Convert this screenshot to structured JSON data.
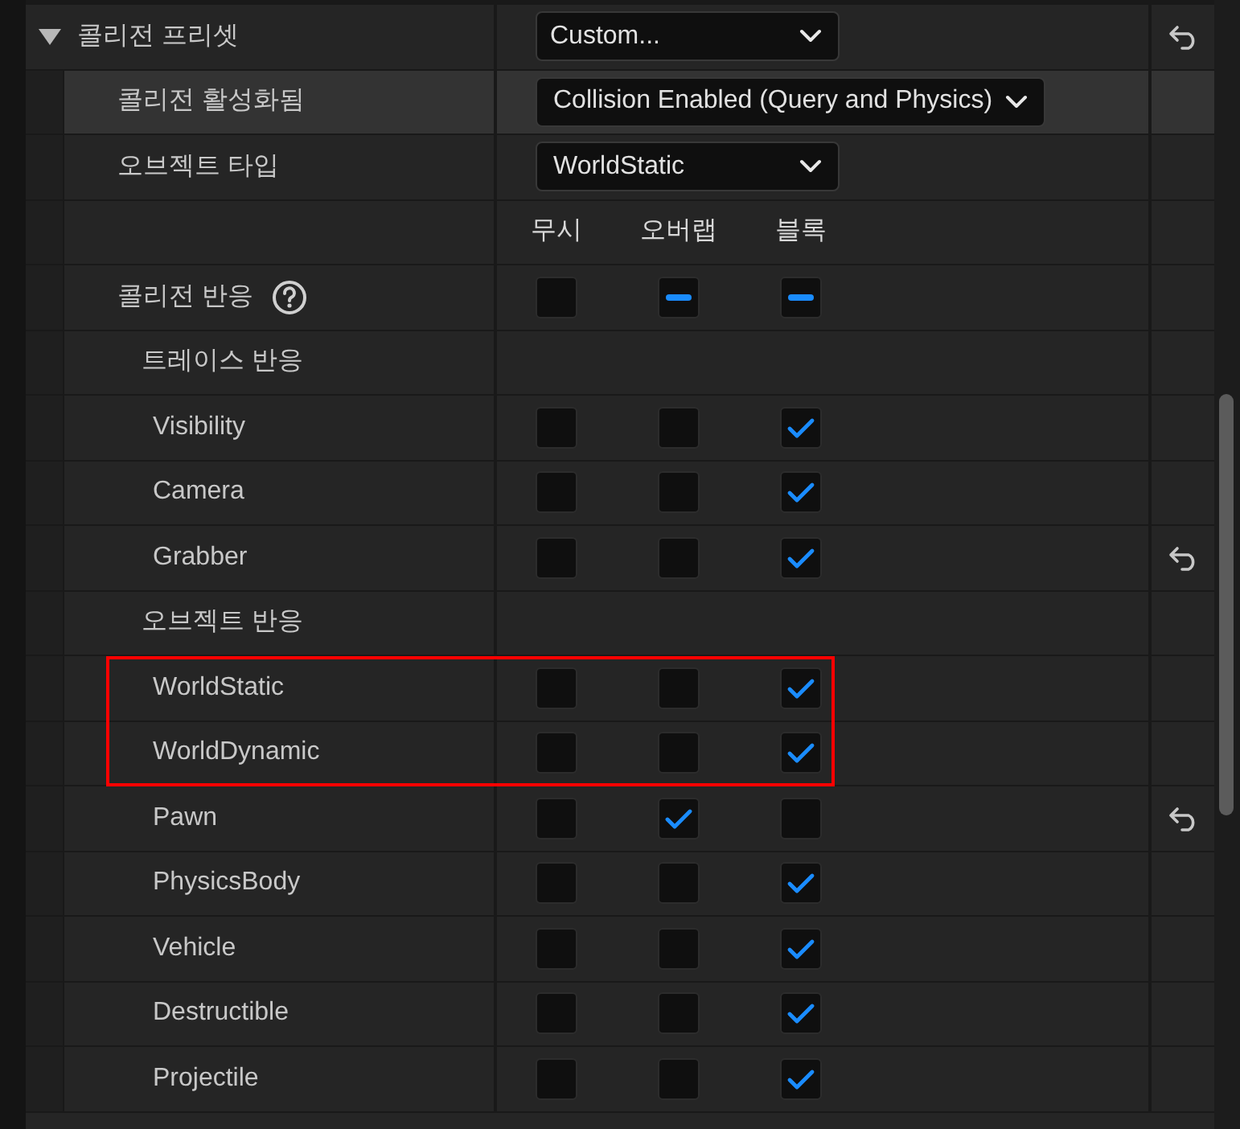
{
  "rows": [
    {
      "kind": "dropdown",
      "label": "콜리전 프리셋",
      "expanded": true,
      "value": "Custom...",
      "reset": true,
      "hovered": false,
      "children": [
        {
          "kind": "dropdown",
          "label": "콜리전 활성화됨",
          "value": "Collision Enabled (Query and Physics)",
          "reset": false,
          "hovered": true
        },
        {
          "kind": "dropdown",
          "label": "오브젝트 타입",
          "value": "WorldStatic",
          "reset": false,
          "hovered": false
        },
        {
          "kind": "header",
          "columns": [
            "무시",
            "오버랩",
            "블록"
          ]
        },
        {
          "kind": "check",
          "label": "콜리전 반응",
          "help": true,
          "reset": false,
          "highlighted": false,
          "boxes": [
            {
              "checked": false
            },
            {
              "mixed": true
            },
            {
              "mixed": true
            }
          ]
        },
        {
          "kind": "category",
          "label": "트레이스 반응",
          "children": [
            {
              "kind": "check",
              "label": "Visibility",
              "help": false,
              "reset": false,
              "highlighted": false,
              "boxes": [
                {
                  "checked": false
                },
                {
                  "checked": false
                },
                {
                  "checked": true
                }
              ]
            },
            {
              "kind": "check",
              "label": "Camera",
              "help": false,
              "reset": false,
              "highlighted": false,
              "boxes": [
                {
                  "checked": false
                },
                {
                  "checked": false
                },
                {
                  "checked": true
                }
              ]
            },
            {
              "kind": "check",
              "label": "Grabber",
              "help": false,
              "reset": true,
              "highlighted": false,
              "boxes": [
                {
                  "checked": false
                },
                {
                  "checked": false
                },
                {
                  "checked": true
                }
              ]
            }
          ]
        },
        {
          "kind": "category",
          "label": "오브젝트 반응",
          "children": [
            {
              "kind": "check",
              "label": "WorldStatic",
              "help": false,
              "reset": false,
              "highlighted": true,
              "boxes": [
                {
                  "checked": false
                },
                {
                  "checked": false
                },
                {
                  "checked": true
                }
              ]
            },
            {
              "kind": "check",
              "label": "WorldDynamic",
              "help": false,
              "reset": false,
              "highlighted": true,
              "boxes": [
                {
                  "checked": false
                },
                {
                  "checked": false
                },
                {
                  "checked": true
                }
              ]
            },
            {
              "kind": "check",
              "label": "Pawn",
              "help": false,
              "reset": true,
              "highlighted": false,
              "boxes": [
                {
                  "checked": false
                },
                {
                  "checked": true
                },
                {
                  "checked": false
                }
              ]
            },
            {
              "kind": "check",
              "label": "PhysicsBody",
              "help": false,
              "reset": false,
              "highlighted": false,
              "boxes": [
                {
                  "checked": false
                },
                {
                  "checked": false
                },
                {
                  "checked": true
                }
              ]
            },
            {
              "kind": "check",
              "label": "Vehicle",
              "help": false,
              "reset": false,
              "highlighted": false,
              "boxes": [
                {
                  "checked": false
                },
                {
                  "checked": false
                },
                {
                  "checked": true
                }
              ]
            },
            {
              "kind": "check",
              "label": "Destructible",
              "help": false,
              "reset": false,
              "highlighted": false,
              "boxes": [
                {
                  "checked": false
                },
                {
                  "checked": false
                },
                {
                  "checked": true
                }
              ]
            },
            {
              "kind": "check",
              "label": "Projectile",
              "help": false,
              "reset": false,
              "highlighted": false,
              "boxes": [
                {
                  "checked": false
                },
                {
                  "checked": false
                },
                {
                  "checked": true
                }
              ]
            }
          ]
        }
      ]
    }
  ]
}
